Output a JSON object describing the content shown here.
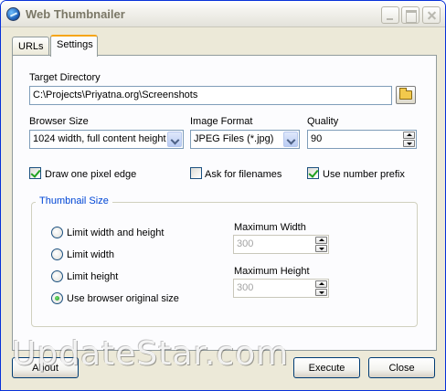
{
  "window": {
    "title": "Web Thumbnailer"
  },
  "tabs": [
    {
      "label": "URLs"
    },
    {
      "label": "Settings"
    }
  ],
  "settings": {
    "target_directory": {
      "label": "Target Directory",
      "value": "C:\\Projects\\Priyatna.org\\Screenshots"
    },
    "browser_size": {
      "label": "Browser Size",
      "value": "1024 width, full content height"
    },
    "image_format": {
      "label": "Image Format",
      "value": "JPEG Files (*.jpg)"
    },
    "quality": {
      "label": "Quality",
      "value": "90"
    },
    "checkboxes": {
      "draw_edge": {
        "label": "Draw one pixel edge",
        "checked": true
      },
      "ask_filenames": {
        "label": "Ask for filenames",
        "checked": false
      },
      "number_prefix": {
        "label": "Use number prefix",
        "checked": true
      }
    },
    "thumbnail_size": {
      "legend": "Thumbnail Size",
      "options": [
        {
          "label": "Limit width and height",
          "selected": false
        },
        {
          "label": "Limit width",
          "selected": false
        },
        {
          "label": "Limit height",
          "selected": false
        },
        {
          "label": "Use browser original size",
          "selected": true
        }
      ],
      "max_width": {
        "label": "Maximum Width",
        "value": "300"
      },
      "max_height": {
        "label": "Maximum Height",
        "value": "300"
      }
    }
  },
  "buttons": {
    "about": "About",
    "execute": "Execute",
    "close": "Close"
  },
  "watermark": "UpdateStar.com",
  "colors": {
    "group_legend": "#0046d5",
    "checkmark": "#21a121",
    "tab_highlight": "#f6a516"
  }
}
